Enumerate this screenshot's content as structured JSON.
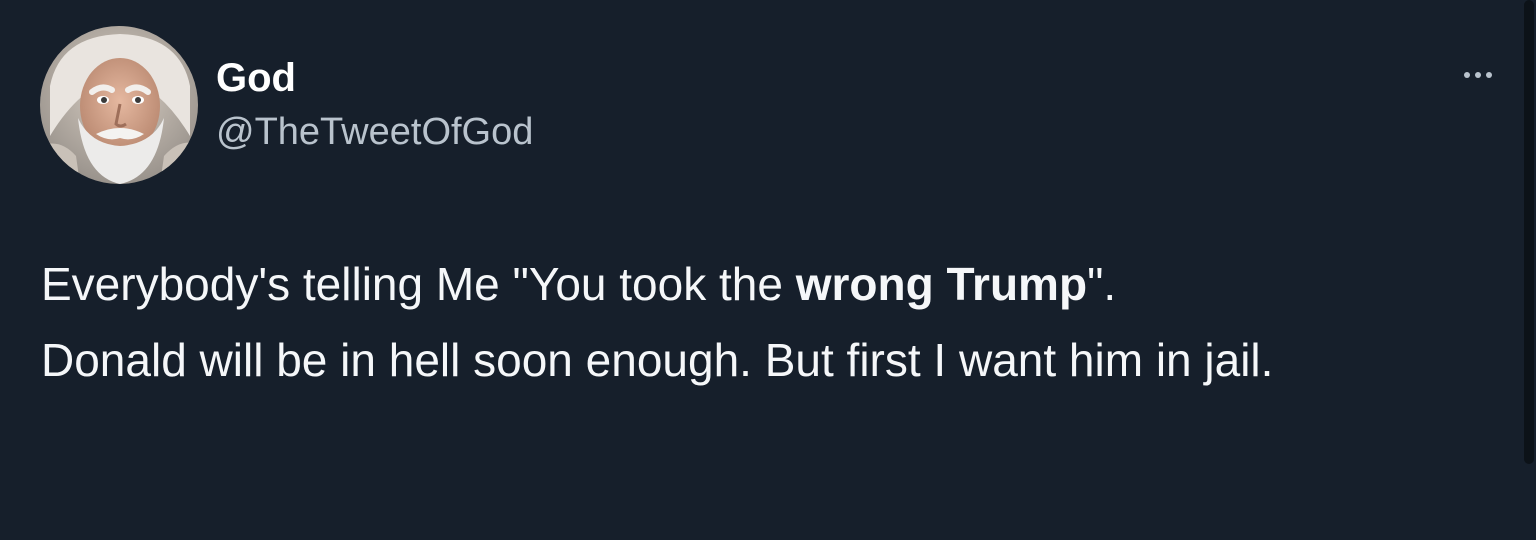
{
  "tweet": {
    "author": {
      "display_name": "God",
      "handle": "@TheTweetOfGod"
    },
    "more_icon": "more-horizontal-icon",
    "text": {
      "line1_before": "Everybody's telling Me \"You took the ",
      "line1_bold": "wrong Trump",
      "line1_after": "\".",
      "paragraph2": "Donald will be in hell soon enough. But first I want him in jail."
    }
  },
  "colors": {
    "background": "#161f2b",
    "text_primary": "#ffffff",
    "text_secondary": "#b9c3cd"
  }
}
